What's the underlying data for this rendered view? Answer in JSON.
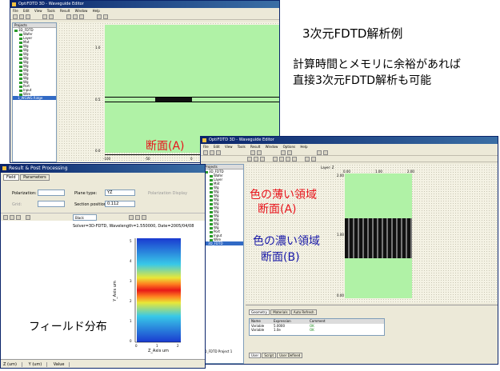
{
  "slide": {
    "heading": "3次元FDTD解析例",
    "note_line1": "計算時間とメモリに余裕があれば",
    "note_line2": "直接3次元FDTD解析も可能",
    "label_section_a": "断面(A)",
    "label_light_line1": "色の薄い領域",
    "label_light_line2": "断面(A)",
    "label_dark_line1": "色の濃い領域",
    "label_dark_line2": "断面(B)",
    "label_field": "フィールド分布"
  },
  "colors": {
    "accent_red": "#e8141c",
    "accent_blue": "#1a1aa8",
    "canvas_green": "#b0f2a6"
  },
  "window_back": {
    "title": "OptiFDTD 3D - Waveguide Editor",
    "menu": [
      "File",
      "Edit",
      "View",
      "Tools",
      "Result",
      "Window",
      "Help"
    ],
    "tree_header": "Projects",
    "tree_items": [
      "3D_FDTD",
      "Wafer",
      "Layer",
      "Mat",
      "Wg",
      "Wg",
      "Wg",
      "Wg",
      "Wg",
      "Wg",
      "Wg",
      "Wg",
      "Wg",
      "Wg",
      "Port",
      "Input",
      "Wire"
    ],
    "tree_selected": "1_WGWG Ridge",
    "y_ticks": [
      "1.0",
      "0.5",
      "0.0",
      "-100"
    ],
    "x_ticks": [
      "-100",
      "-50",
      "0",
      "50",
      "100"
    ]
  },
  "window_front": {
    "title": "OptiFDTD 3D - Waveguide Editor",
    "menu": [
      "File",
      "Edit",
      "View",
      "Tools",
      "Result",
      "Window",
      "Options",
      "Help"
    ],
    "tree_header": "Projects",
    "tree_items": [
      "3D_FDTD",
      "Wafer",
      "Layer",
      "Mat",
      "Wg",
      "Wg",
      "Wg",
      "Wg",
      "Wg",
      "Wg",
      "Wg",
      "Wg",
      "Wg",
      "Wg",
      "Wg",
      "Port",
      "Input",
      "Wire"
    ],
    "tree_selected": "3D_FDTD",
    "canvas_title": "Layer: Z",
    "x_ticks": [
      "0.00",
      "1.00",
      "2.00"
    ],
    "y_ticks": [
      "2.00",
      "1.00",
      "0.00"
    ],
    "status_tabs": [
      "Geometry",
      "Materials",
      "Auto Refresh"
    ],
    "table_headers": [
      "Name",
      "Expression",
      "Comment"
    ],
    "table_rows": [
      [
        "Variable",
        "5.0000",
        "OK"
      ],
      [
        "Variable",
        "1.0e",
        "OK"
      ]
    ],
    "bottom_tabs": [
      "User",
      "Script",
      "User Defined"
    ],
    "bottom_label": "3D_FDTD Project 1"
  },
  "dialog": {
    "title": "Result & Post Processing",
    "tabs": [
      "Field",
      "Parameters"
    ],
    "polarization_label": "Polarization:",
    "polarization_value": "",
    "plane_type_label": "Plane type:",
    "plane_type_value": "YZ",
    "polar_display_label": "Polarization Display",
    "grid_label": "Grid:",
    "grid_value": "",
    "section_position_label": "Section position:",
    "section_position_value": "0.112",
    "plot_title": "Solver=3D-FDTD, Wavelength=1.550000, Date=2005/04/08",
    "y_axis_label": "Y_Axis um",
    "x_axis_label": "Z_Axis um",
    "y_ticks": [
      "5",
      "4",
      "3",
      "2",
      "1",
      "0"
    ],
    "x_ticks": [
      "0",
      "1",
      "2"
    ],
    "status_fields": [
      "Z (um)",
      "Y (um)",
      "Value"
    ],
    "color_select": "Black"
  }
}
